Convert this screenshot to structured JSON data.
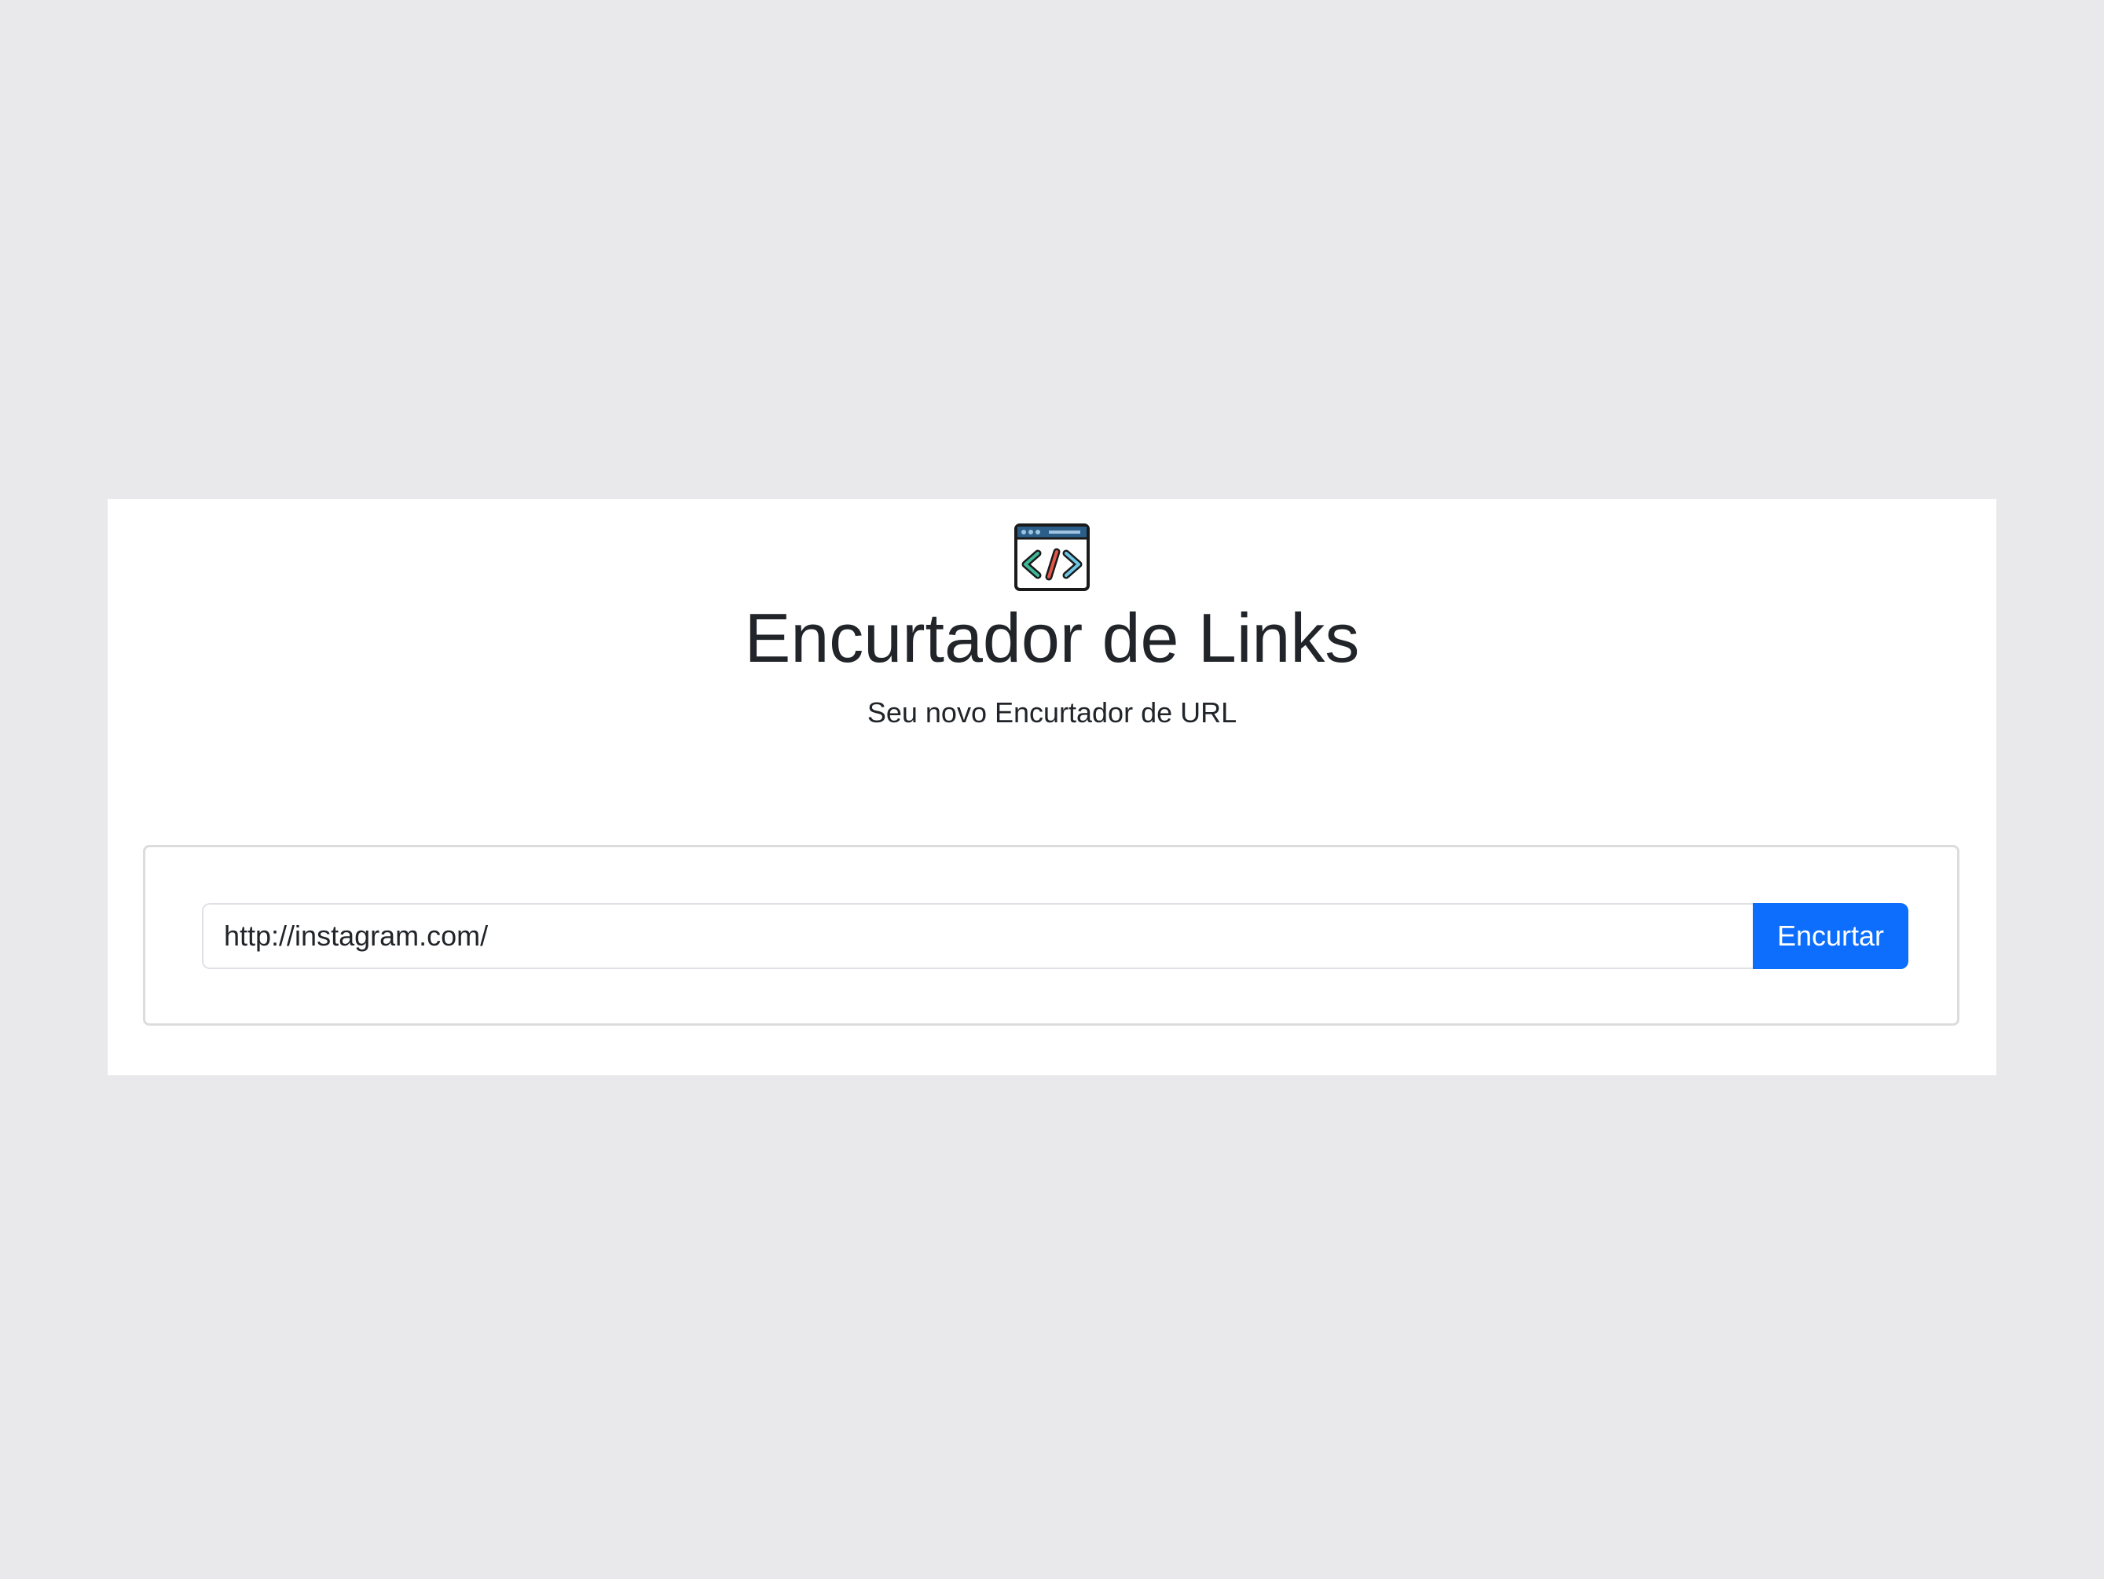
{
  "header": {
    "logo_icon": "code-window-icon",
    "title": "Encurtador de Links",
    "subtitle": "Seu novo Encurtador de URL"
  },
  "form": {
    "url_value": "http://instagram.com/",
    "submit_label": "Encurtar"
  },
  "colors": {
    "background": "#e9e9eb",
    "panel": "#ffffff",
    "accent": "#0d6efd",
    "text": "#212529"
  }
}
